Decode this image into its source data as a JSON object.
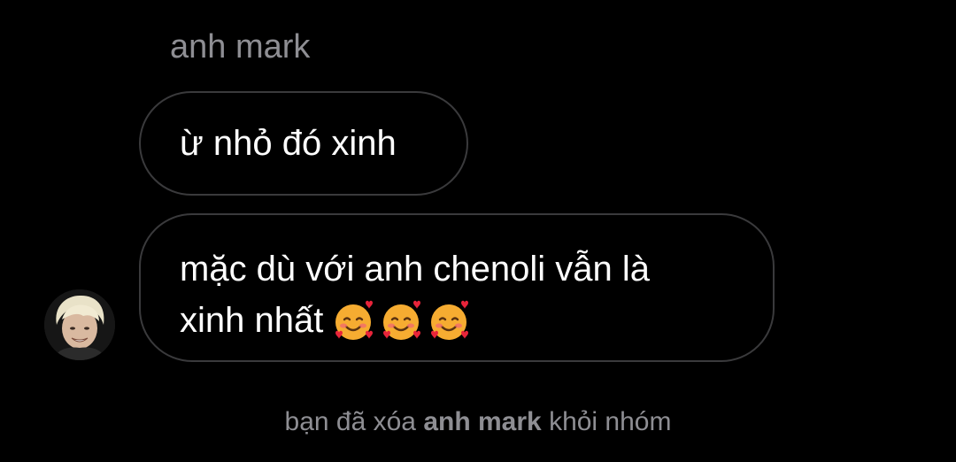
{
  "thread": {
    "sender_name": "anh mark",
    "messages": [
      {
        "text": "ừ nhỏ đó xinh"
      },
      {
        "line1": "mặc dù với anh chenoli vẫn là",
        "line2": "xinh nhất",
        "emoji": [
          "smiling-face-with-hearts",
          "smiling-face-with-hearts",
          "smiling-face-with-hearts"
        ]
      }
    ],
    "system": {
      "prefix": "bạn đã xóa",
      "name": "anh mark",
      "suffix": "khỏi nhóm"
    }
  },
  "colors": {
    "background": "#000000",
    "bubble_border": "#3a3a3c",
    "secondary_text": "#8e8e93",
    "primary_text": "#ffffff"
  }
}
